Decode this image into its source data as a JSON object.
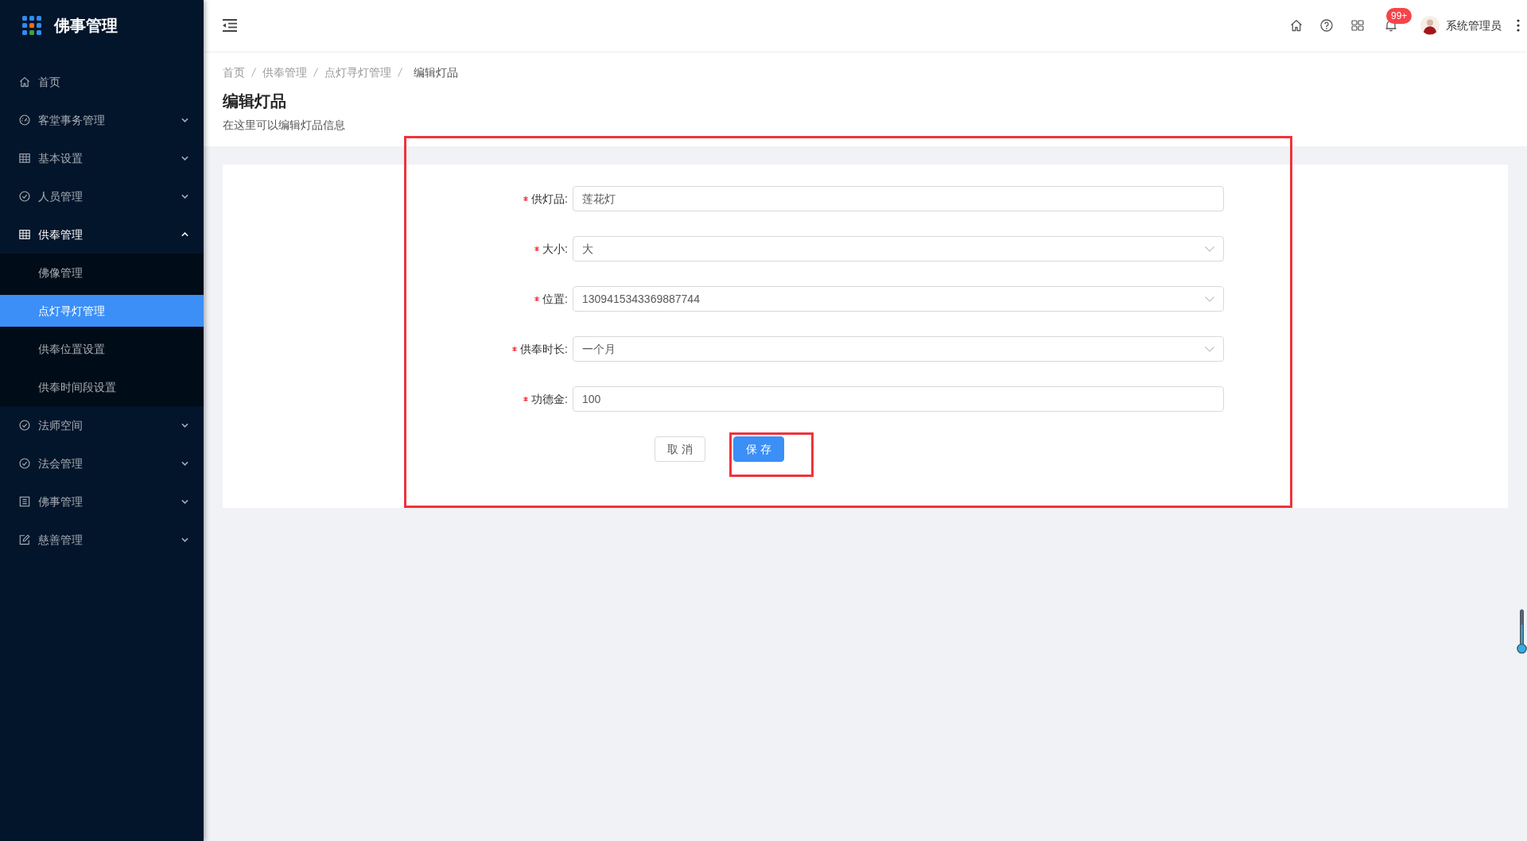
{
  "sidebar": {
    "logo_title": "佛事管理",
    "menu": [
      {
        "kind": "link",
        "label": "首页",
        "selected": false
      },
      {
        "kind": "submenu",
        "label": "客堂事务管理",
        "selected": false,
        "expanded": false
      },
      {
        "kind": "submenu",
        "label": "基本设置",
        "selected": false,
        "expanded": false
      },
      {
        "kind": "submenu",
        "label": "人员管理",
        "selected": false,
        "expanded": false
      },
      {
        "kind": "submenu",
        "label": "供奉管理",
        "selected": true,
        "expanded": true,
        "children": [
          {
            "label": "佛像管理",
            "selected": false
          },
          {
            "label": "点灯寻灯管理",
            "selected": true
          },
          {
            "label": "供奉位置设置",
            "selected": false
          },
          {
            "label": "供奉时间段设置",
            "selected": false
          }
        ]
      },
      {
        "kind": "submenu",
        "label": "法师空间",
        "selected": false,
        "expanded": false
      },
      {
        "kind": "submenu",
        "label": "法会管理",
        "selected": false,
        "expanded": false
      },
      {
        "kind": "submenu",
        "label": "佛事管理",
        "selected": false,
        "expanded": false
      },
      {
        "kind": "submenu",
        "label": "慈善管理",
        "selected": false,
        "expanded": false
      }
    ]
  },
  "header": {
    "notification_badge": "99+",
    "user_name": "系统管理员"
  },
  "page_header": {
    "breadcrumb": [
      {
        "label": "首页",
        "current": false
      },
      {
        "label": "供奉管理",
        "current": false
      },
      {
        "label": "点灯寻灯管理",
        "current": false
      },
      {
        "label": "编辑灯品",
        "current": true
      }
    ],
    "title": "编辑灯品",
    "subtitle": "在这里可以编辑灯品信息"
  },
  "form": {
    "highlighted": true,
    "fields": [
      {
        "kind": "input",
        "label": "供灯品:",
        "required": true,
        "value": "莲花灯"
      },
      {
        "kind": "select",
        "label": "大小:",
        "required": true,
        "value": "大"
      },
      {
        "kind": "select",
        "label": "位置:",
        "required": true,
        "value": "1309415343369887744"
      },
      {
        "kind": "select",
        "label": "供奉时长:",
        "required": true,
        "value": "一个月"
      },
      {
        "kind": "input",
        "label": "功德金:",
        "required": true,
        "value": "100"
      }
    ],
    "buttons": [
      {
        "kind": "default",
        "label": "取 消",
        "highlighted": false
      },
      {
        "kind": "primary",
        "label": "保 存",
        "highlighted": true
      }
    ]
  }
}
